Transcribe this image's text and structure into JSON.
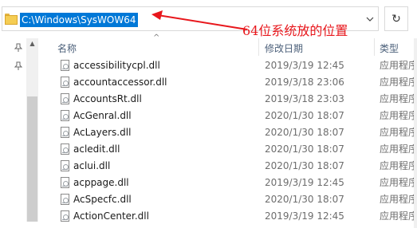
{
  "address_bar": {
    "path": "C:\\Windows\\SysWOW64",
    "dropdown_glyph": "˅",
    "refresh_glyph": "↻"
  },
  "annotation": {
    "text": "64位系统放的位置",
    "color": "#e8171c"
  },
  "left_pane": {
    "pin_glyph": "📌"
  },
  "columns": {
    "name": "名称",
    "date": "修改日期",
    "type": "类型"
  },
  "files": [
    {
      "name": "accessibilitycpl.dll",
      "date": "2019/3/19 12:45",
      "type": "应用程序扩展"
    },
    {
      "name": "accountaccessor.dll",
      "date": "2019/3/18 23:06",
      "type": "应用程序扩展"
    },
    {
      "name": "AccountsRt.dll",
      "date": "2019/3/18 23:03",
      "type": "应用程序扩展"
    },
    {
      "name": "AcGenral.dll",
      "date": "2020/1/30 18:07",
      "type": "应用程序扩展"
    },
    {
      "name": "AcLayers.dll",
      "date": "2020/1/30 18:07",
      "type": "应用程序扩展"
    },
    {
      "name": "acledit.dll",
      "date": "2020/1/30 18:07",
      "type": "应用程序扩展"
    },
    {
      "name": "aclui.dll",
      "date": "2020/1/30 18:07",
      "type": "应用程序扩展"
    },
    {
      "name": "acppage.dll",
      "date": "2019/3/19 12:45",
      "type": "应用程序扩展"
    },
    {
      "name": "AcSpecfc.dll",
      "date": "2020/1/30 18:07",
      "type": "应用程序扩展"
    },
    {
      "name": "ActionCenter.dll",
      "date": "2019/3/19 12:45",
      "type": "应用程序扩展"
    }
  ],
  "colors": {
    "selection": "#0078d7",
    "header_text": "#4c607a"
  }
}
